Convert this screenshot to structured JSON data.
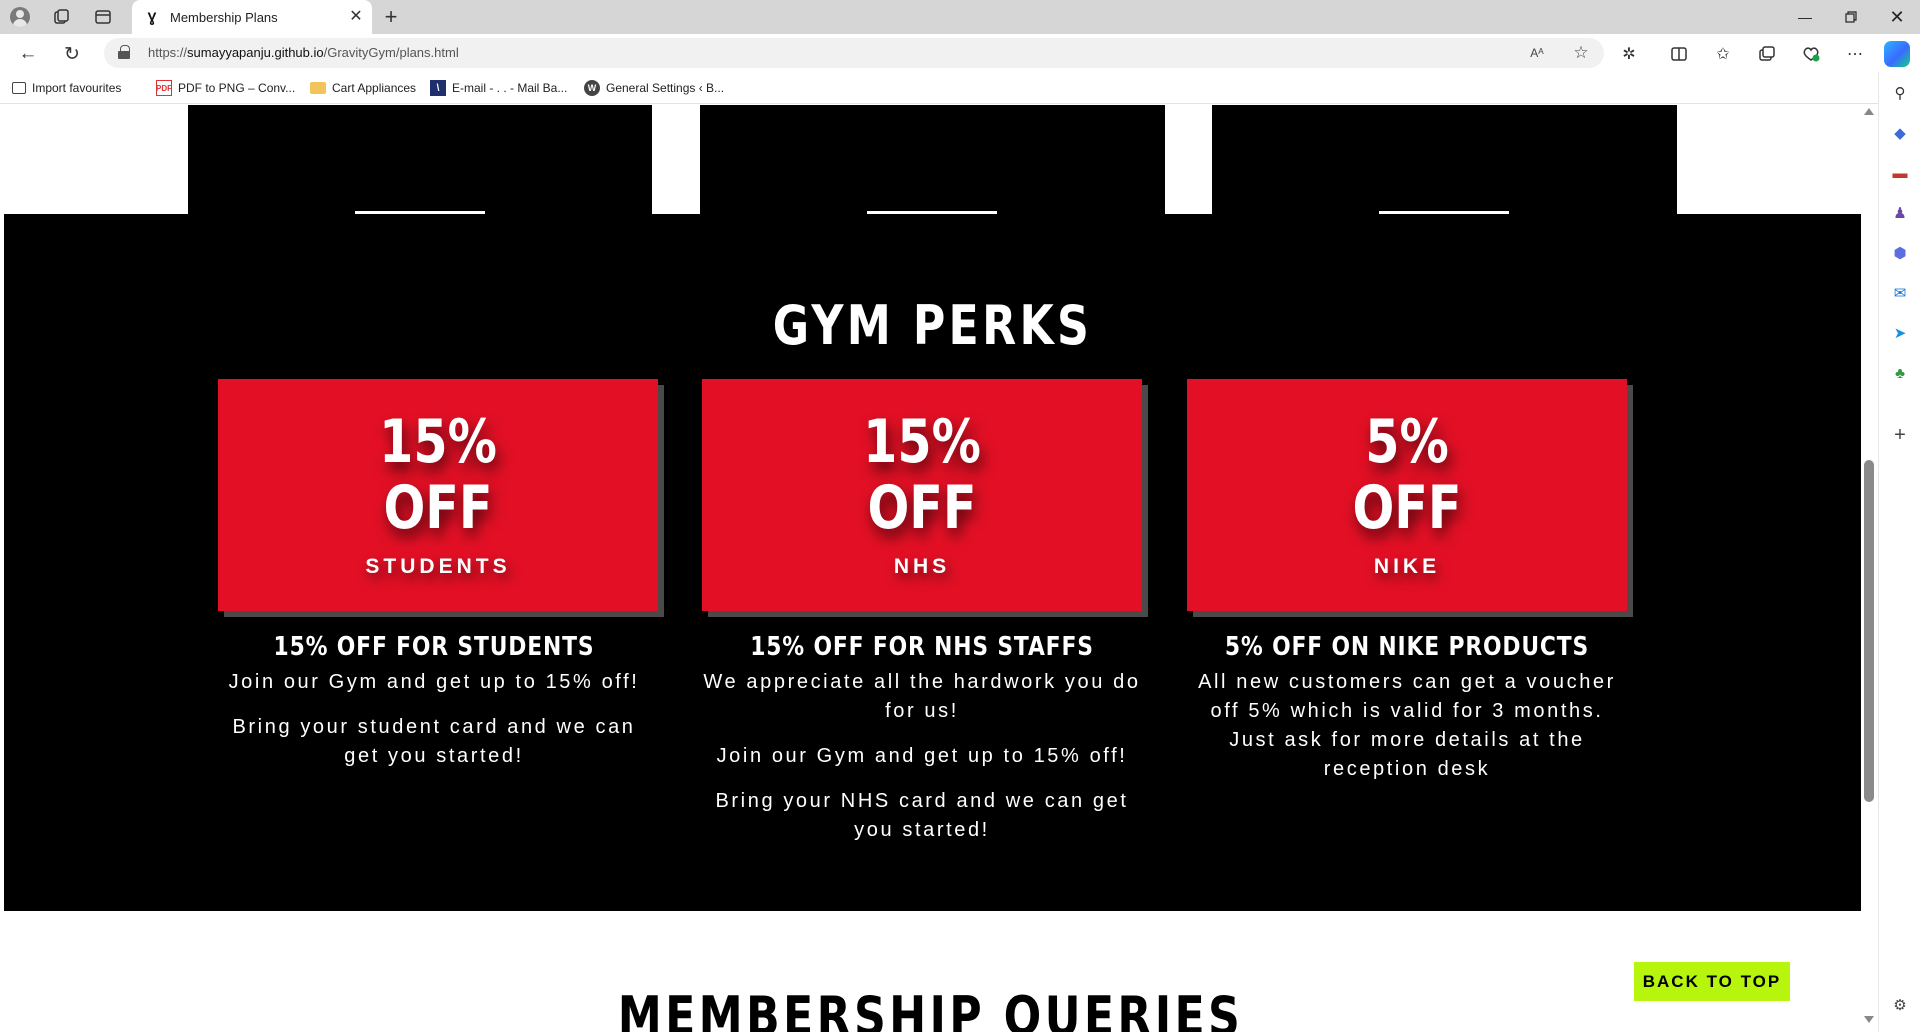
{
  "browser": {
    "tab_title": "Membership Plans",
    "tab_favicon": "Ɣ",
    "url_prefix": "https://",
    "url_host": "sumayyapanju.github.io",
    "url_path": "/GravityGym/plans.html",
    "read_aloud": "Aᴬ",
    "favourites": [
      {
        "label": "Import favourites",
        "icon": "import-icon"
      },
      {
        "label": "PDF to PNG – Conv...",
        "icon": "pdf-icon"
      },
      {
        "label": "Cart Appliances",
        "icon": "folder-icon"
      },
      {
        "label": "E-mail - . . - Mail Ba...",
        "icon": "mail-icon"
      },
      {
        "label": "General Settings ‹ B...",
        "icon": "wordpress-icon"
      }
    ]
  },
  "perks": {
    "title": "GYM PERKS",
    "cards": [
      {
        "percent": "15%",
        "off": "OFF",
        "who": "STUDENTS",
        "heading": "15% OFF FOR STUDENTS",
        "paragraphs": [
          "Join our Gym and get up to 15% off!",
          "Bring your student card and we can get you started!"
        ]
      },
      {
        "percent": "15%",
        "off": "OFF",
        "who": "NHS",
        "heading": "15% OFF FOR NHS STAFFS",
        "paragraphs": [
          "We appreciate all the hardwork you do for us!",
          "Join our Gym and get up to 15% off!",
          "Bring your NHS card and we can get you started!"
        ]
      },
      {
        "percent": "5%",
        "off": "OFF",
        "who": "NIKE",
        "heading": "5% OFF ON NIKE PRODUCTS",
        "paragraphs": [
          "All new customers can get a voucher off 5% which is valid for 3 months. Just ask for more details at the reception desk"
        ]
      }
    ]
  },
  "queries": {
    "title": "MEMBERSHIP QUERIES"
  },
  "back_to_top": "BACK TO TOP",
  "colors": {
    "perk_red": "#e31025",
    "back_to_top_green": "#b8f50c"
  }
}
